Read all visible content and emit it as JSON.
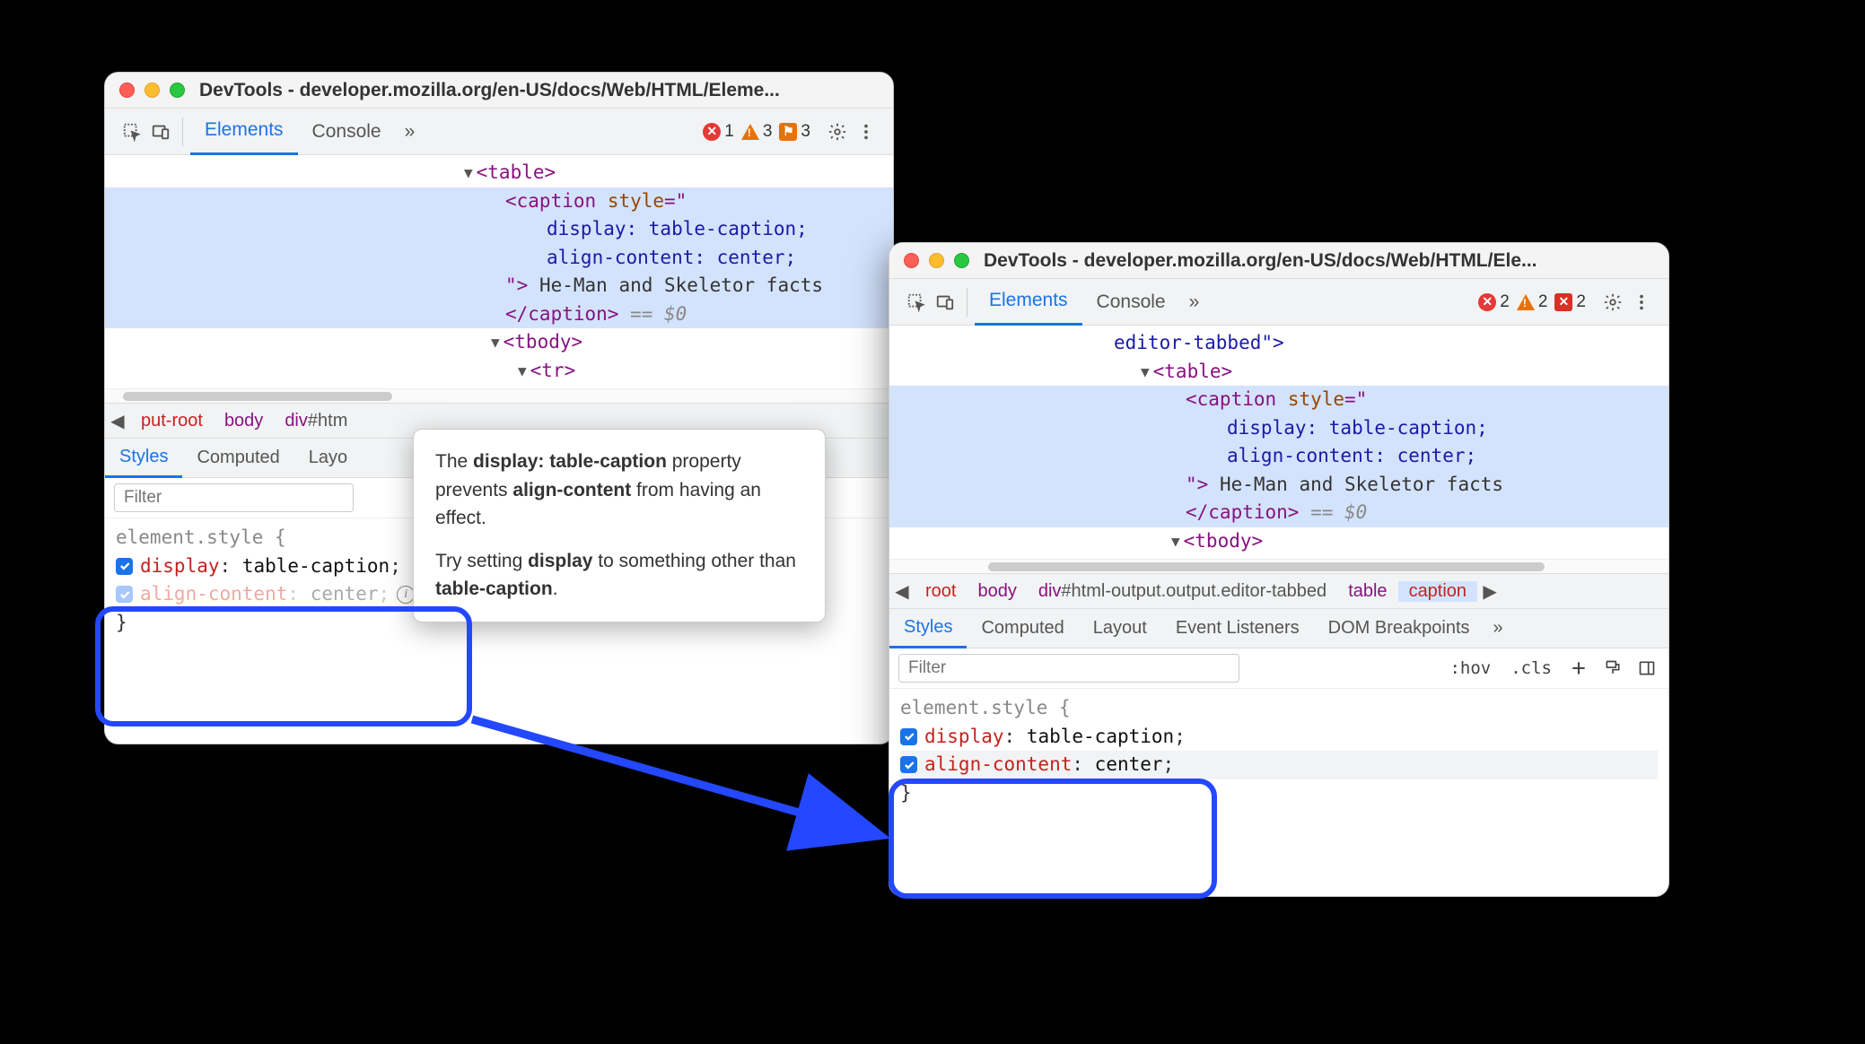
{
  "window1": {
    "title": "DevTools - developer.mozilla.org/en-US/docs/Web/HTML/Eleme...",
    "tabs": {
      "elements": "Elements",
      "console": "Console"
    },
    "counts": {
      "errors": "1",
      "warnings": "3",
      "issues": "3"
    },
    "dom": {
      "table": "<table>",
      "caption_open": "<caption",
      "style_attr": "style",
      "style_val_1": "display: table-caption;",
      "style_val_2": "align-content: center;",
      "caption_text": " He-Man and Skeletor facts",
      "caption_close": "</caption>",
      "eq0": "== $0",
      "tbody": "<tbody>",
      "tr": "<tr>"
    },
    "breadcrumb": {
      "chev": "◀",
      "root": "put-root",
      "body": "body",
      "div": "div#htm"
    },
    "subtabs": {
      "styles": "Styles",
      "computed": "Computed",
      "layout": "Layo"
    },
    "filter_placeholder": "Filter",
    "styles": {
      "selector": "element.style {",
      "display_name": "display",
      "display_val": "table-caption",
      "align_name": "align-content",
      "align_val": "center",
      "close": "}"
    }
  },
  "window2": {
    "title": "DevTools - developer.mozilla.org/en-US/docs/Web/HTML/Ele...",
    "tabs": {
      "elements": "Elements",
      "console": "Console"
    },
    "counts": {
      "errors": "2",
      "warnings": "2",
      "issues": "2"
    },
    "dom": {
      "prev": "editor-tabbed\">",
      "table": "<table>",
      "caption_open": "<caption",
      "style_attr": "style",
      "style_val_1": "display: table-caption;",
      "style_val_2": "align-content: center;",
      "caption_text": " He-Man and Skeletor facts",
      "caption_close": "</caption>",
      "eq0": "== $0",
      "tbody": "<tbody>"
    },
    "breadcrumb": {
      "chev": "◀",
      "root": "root",
      "body": "body",
      "div": "div#html-output.output.editor-tabbed",
      "table": "table",
      "caption": "caption",
      "chev_r": "▶"
    },
    "subtabs": {
      "styles": "Styles",
      "computed": "Computed",
      "layout": "Layout",
      "events": "Event Listeners",
      "dom_bp": "DOM Breakpoints"
    },
    "filter_placeholder": "Filter",
    "filter_tools": {
      "hov": ":hov",
      "cls": ".cls"
    },
    "styles": {
      "selector": "element.style {",
      "display_name": "display",
      "display_val": "table-caption",
      "align_name": "align-content",
      "align_val": "center",
      "close": "}"
    }
  },
  "tooltip": {
    "line1_pre": "The ",
    "line1_b1": "display: table-caption",
    "line1_mid": " property prevents ",
    "line1_b2": "align-content",
    "line1_post": " from having an effect.",
    "line2_pre": "Try setting ",
    "line2_b1": "display",
    "line2_mid": " to something other than ",
    "line2_b2": "table-caption",
    "line2_post": "."
  }
}
